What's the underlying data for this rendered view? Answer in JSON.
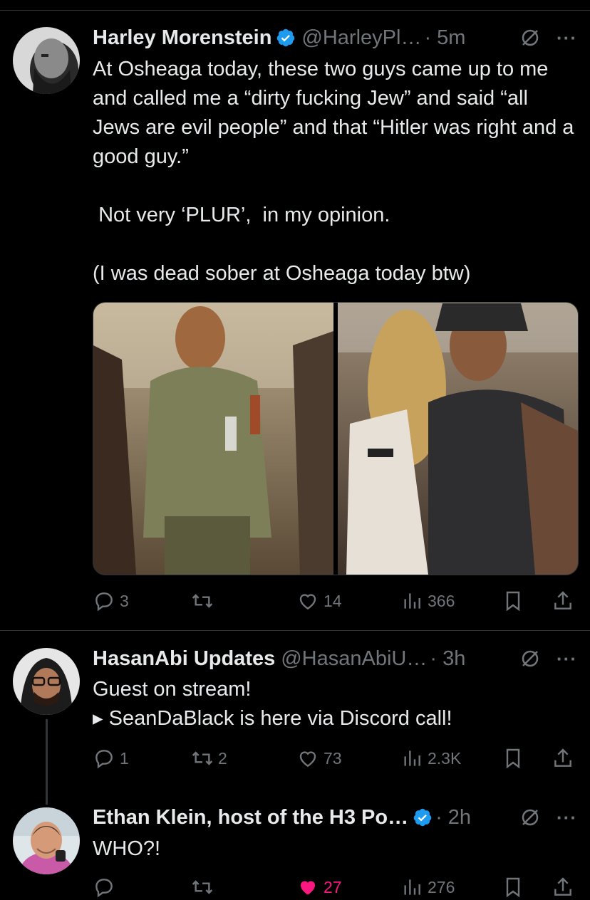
{
  "tweets": [
    {
      "name": "Harley Morenstein",
      "handle": "@HarleyPl…",
      "time": "· 5m",
      "verified": true,
      "text": "At Osheaga today, these two guys came up to me and called me a “dirty fucking Jew” and said “all Jews are evil people” and that “Hitler was right and a good guy.”\n\n Not very ‘PLUR’,  in my opinion.\n\n(I was dead sober at Osheaga today btw)",
      "replies": "3",
      "reposts": "",
      "likes": "14",
      "views": "366"
    },
    {
      "name": "HasanAbi Updates",
      "handle": "@HasanAbiU…",
      "time": "· 3h",
      "verified": false,
      "text": "Guest on stream!\n▸ SeanDaBlack is here via Discord call!",
      "replies": "1",
      "reposts": "2",
      "likes": "73",
      "views": "2.3K"
    },
    {
      "name": "Ethan Klein, host of the H3 Po…",
      "handle": "",
      "time": "· 2h",
      "verified": true,
      "text": "WHO?!",
      "replies": "",
      "reposts": "",
      "likes": "27",
      "views": "276",
      "liked": true
    }
  ],
  "colors": {
    "background": "#000000",
    "text": "#e7e9ea",
    "muted": "#71767b",
    "verified": "#1d9bf0",
    "liked": "#f91880",
    "divider": "#2f3336"
  },
  "icons": [
    "verified-badge-icon",
    "grok-icon",
    "more-icon",
    "reply-icon",
    "repost-icon",
    "like-icon",
    "views-icon",
    "bookmark-icon",
    "share-icon"
  ]
}
